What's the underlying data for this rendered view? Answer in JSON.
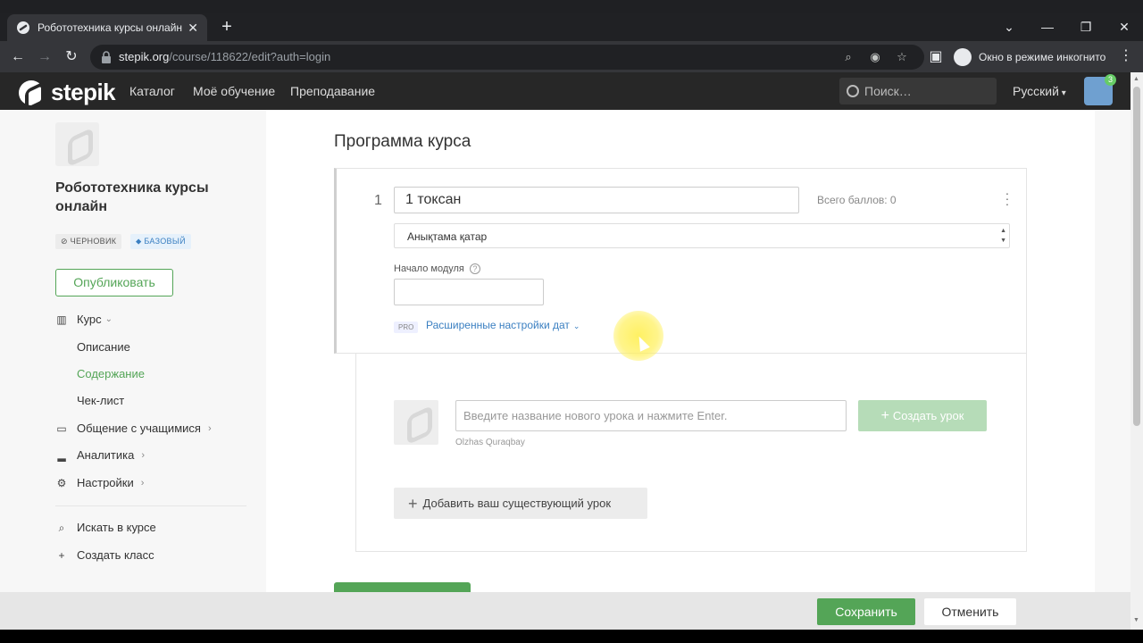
{
  "browser": {
    "tab_title": "Робототехника курсы онлайн · Stepik",
    "tab_close": "✕",
    "new_tab": "+",
    "url_host": "stepik.org",
    "url_path": "/course/118622/edit?auth=login",
    "incognito_label": "Окно в режиме инкогнито"
  },
  "header": {
    "logo_text": "stepik",
    "nav": [
      "Каталог",
      "Моё обучение",
      "Преподавание"
    ],
    "search_placeholder": "Поиск…",
    "language": "Русский",
    "notifications_count": "3"
  },
  "sidebar": {
    "course_title": "Робототехника курсы онлайн",
    "tag_draft": "ЧЕРНОВИК",
    "tag_basic": "БАЗОВЫЙ",
    "publish_label": "Опубликовать",
    "course_label": "Курс",
    "course_items": [
      "Описание",
      "Содержание",
      "Чек-лист"
    ],
    "communication_label": "Общение с учащимися",
    "analytics_label": "Аналитика",
    "settings_label": "Настройки",
    "search_label": "Искать в курсе",
    "create_class_label": "Создать класс"
  },
  "main": {
    "title": "Программа курса",
    "module": {
      "number": "1",
      "title": "1 токсан",
      "points": "Всего баллов: 0",
      "description": "Анықтама қатар",
      "start_label": "Начало модуля",
      "pro_badge": "PRO",
      "advanced_dates": "Расширенные настройки дат"
    },
    "lessons": {
      "input_placeholder": "Введите название нового урока и нажмите Enter.",
      "author": "Olzhas Quraqbay",
      "create_label": "Создать урок",
      "add_existing_label": "Добавить ваш существующий урок"
    }
  },
  "footer": {
    "save_label": "Сохранить",
    "cancel_label": "Отменить"
  },
  "colors": {
    "brand_green": "#54a557",
    "link_blue": "#3a7fc1",
    "header_bg": "#272727"
  }
}
